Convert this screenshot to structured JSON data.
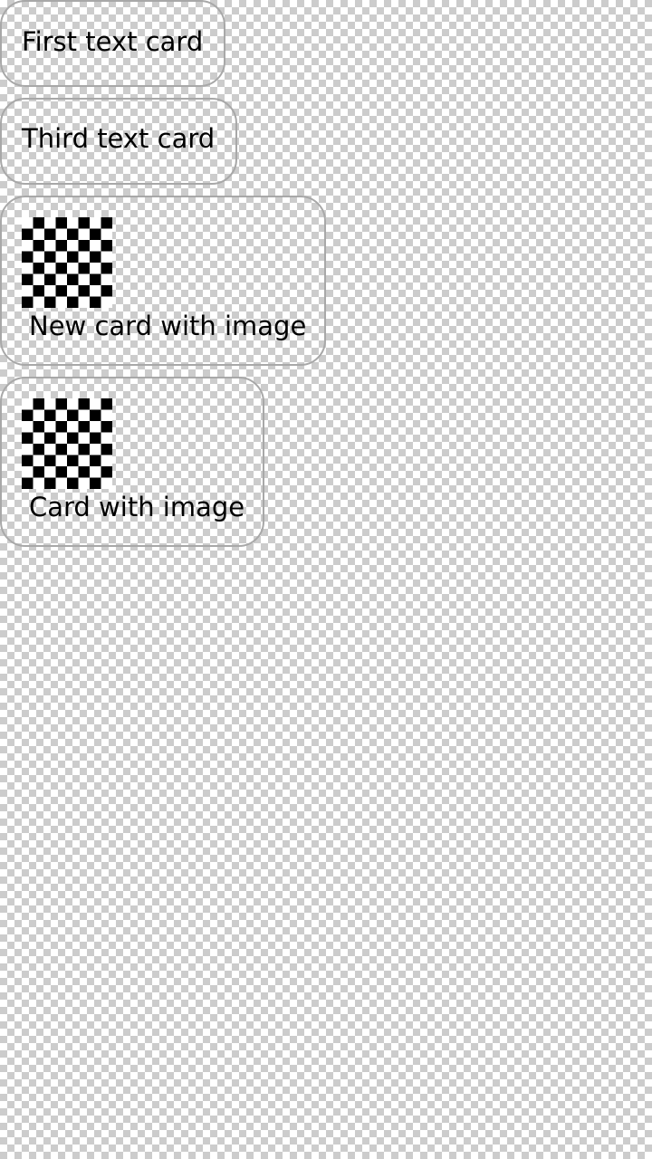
{
  "cards": [
    {
      "label": "First text card",
      "has_image": false
    },
    {
      "label": "Third text card",
      "has_image": false
    },
    {
      "label": "New card with image",
      "has_image": true,
      "image_icon": "checkerboard-image"
    },
    {
      "label": "Card with image",
      "has_image": true,
      "image_icon": "checkerboard-image"
    }
  ],
  "colors": {
    "card_border": "#a8a8a8",
    "text": "#000000",
    "background_checker": "#cccccc"
  }
}
